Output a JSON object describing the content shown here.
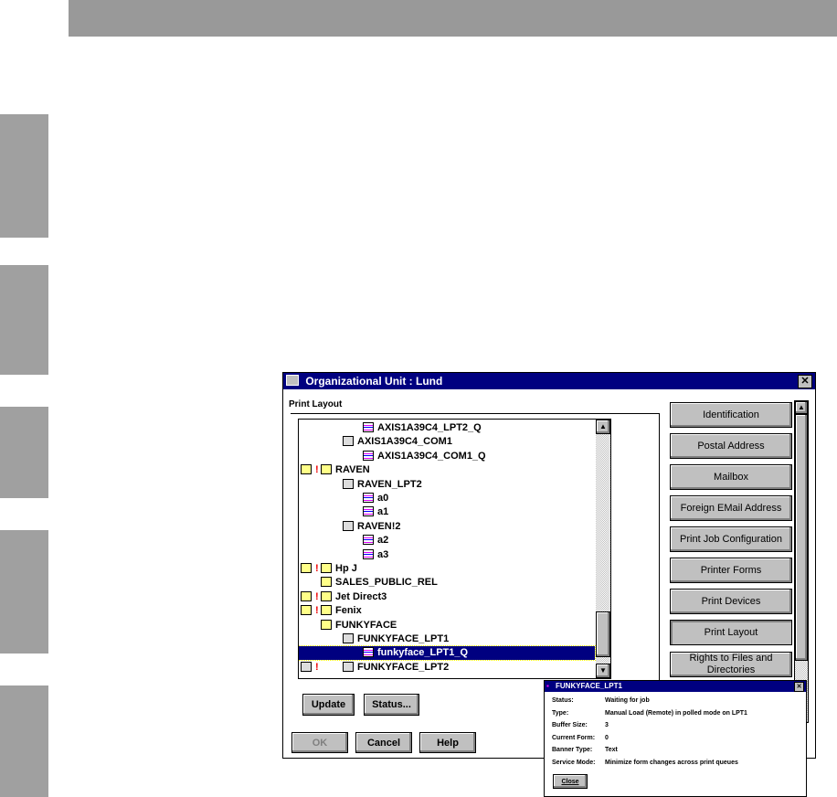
{
  "dialog": {
    "title": "Organizational Unit : Lund",
    "group_label": "Print Layout",
    "tree": [
      {
        "label": "AXIS1A39C4_LPT2_Q",
        "level": 2,
        "icon": "queue-icon"
      },
      {
        "label": "AXIS1A39C4_COM1",
        "level": 1,
        "icon": "printer-icon"
      },
      {
        "label": "AXIS1A39C4_COM1_Q",
        "level": 2,
        "icon": "queue-icon"
      },
      {
        "label": "RAVEN",
        "level": 0,
        "icon": "print-server-icon",
        "warn": true
      },
      {
        "label": "RAVEN_LPT2",
        "level": 1,
        "icon": "printer-icon"
      },
      {
        "label": "a0",
        "level": 2,
        "icon": "queue-icon"
      },
      {
        "label": "a1",
        "level": 2,
        "icon": "queue-icon"
      },
      {
        "label": "RAVEN!2",
        "level": 1,
        "icon": "printer-icon"
      },
      {
        "label": "a2",
        "level": 2,
        "icon": "queue-icon"
      },
      {
        "label": "a3",
        "level": 2,
        "icon": "queue-icon"
      },
      {
        "label": "Hp J",
        "level": 0,
        "icon": "print-server-icon",
        "warn": true
      },
      {
        "label": "SALES_PUBLIC_REL",
        "level": 0,
        "icon": "print-server-icon"
      },
      {
        "label": "Jet Direct3",
        "level": 0,
        "icon": "print-server-icon",
        "warn": true
      },
      {
        "label": "Fenix",
        "level": 0,
        "icon": "print-server-icon",
        "warn": true
      },
      {
        "label": "FUNKYFACE",
        "level": 0,
        "icon": "print-server-icon"
      },
      {
        "label": "FUNKYFACE_LPT1",
        "level": 1,
        "icon": "printer-icon"
      },
      {
        "label": "funkyface_LPT1_Q",
        "level": 2,
        "icon": "queue-icon",
        "selected": true
      },
      {
        "label": "FUNKYFACE_LPT2",
        "level": 1,
        "icon": "printer-icon",
        "warn_printer": true
      }
    ],
    "update": "Update",
    "status": "Status...",
    "ok": "OK",
    "cancel": "Cancel",
    "help": "Help",
    "pages": [
      "Identification",
      "Postal Address",
      "Mailbox",
      "Foreign EMail Address",
      "Print Job Configuration",
      "Printer Forms",
      "Print Devices",
      "Print Layout",
      "Rights to Files and Directories"
    ]
  },
  "popup": {
    "title": "FUNKYFACE_LPT1",
    "close": "Close",
    "fields": [
      {
        "label": "Status:",
        "value": "Waiting for job"
      },
      {
        "label": "Type:",
        "value": "Manual Load (Remote) in polled mode on LPT1"
      },
      {
        "label": "Buffer Size:",
        "value": "3"
      },
      {
        "label": "Current Form:",
        "value": "0"
      },
      {
        "label": "Banner Type:",
        "value": "Text"
      },
      {
        "label": "Service Mode:",
        "value": "Minimize form changes across print queues"
      }
    ]
  }
}
